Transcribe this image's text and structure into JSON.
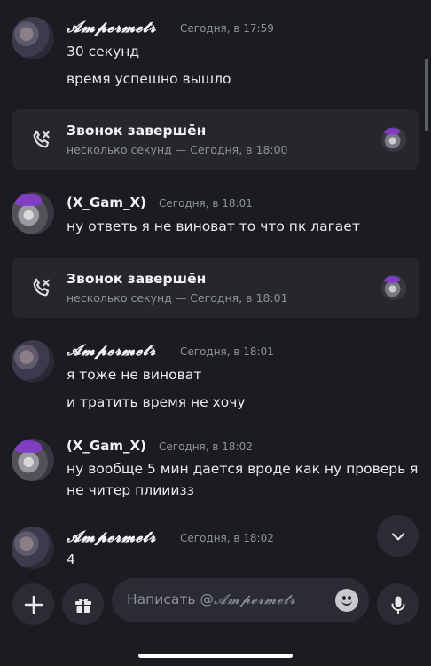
{
  "messages": [
    {
      "author": "𝓐𝓶𝓹𝓮𝓻𝓶𝓮𝓽𝓻",
      "time": "Сегодня, в 17:59",
      "lines": [
        "30 секунд",
        "время успешно вышло"
      ]
    },
    {
      "author": "(X_Gam_X)",
      "time": "Сегодня, в 18:01",
      "lines": [
        "ну ответь я не виноват то что пк лагает"
      ]
    },
    {
      "author": "𝓐𝓶𝓹𝓮𝓻𝓶𝓮𝓽𝓻",
      "time": "Сегодня, в 18:01",
      "lines": [
        "я тоже не виноват",
        "и тратить время не хочу"
      ]
    },
    {
      "author": "(X_Gam_X)",
      "time": "Сегодня, в 18:02",
      "lines": [
        "ну вообще 5 мин дается вроде как ну проверь я",
        "не читер плииизз"
      ]
    },
    {
      "author": "𝓐𝓶𝓹𝓮𝓻𝓶𝓮𝓽𝓻",
      "time": "Сегодня, в 18:02",
      "lines": [
        "4"
      ]
    }
  ],
  "calls": [
    {
      "title": "Звонок завершён",
      "subtitle": "несколько секунд — Сегодня, в 18:00"
    },
    {
      "title": "Звонок завершён",
      "subtitle": "несколько секунд — Сегодня, в 18:01"
    }
  ],
  "composer": {
    "placeholder_prefix": "Написать @",
    "placeholder_name": "𝓐𝓶𝓹𝓮𝓻𝓶𝓮𝓽𝓻"
  },
  "icons": {
    "plus": "plus-icon",
    "gift": "gift-icon",
    "emoji": "emoji-icon",
    "mic": "microphone-icon",
    "phone": "phone-icon",
    "chevron": "chevron-down-icon"
  },
  "colors": {
    "background": "#1b1c21",
    "card": "#26272d",
    "button": "#2b2c33",
    "muted": "#8e9199"
  }
}
